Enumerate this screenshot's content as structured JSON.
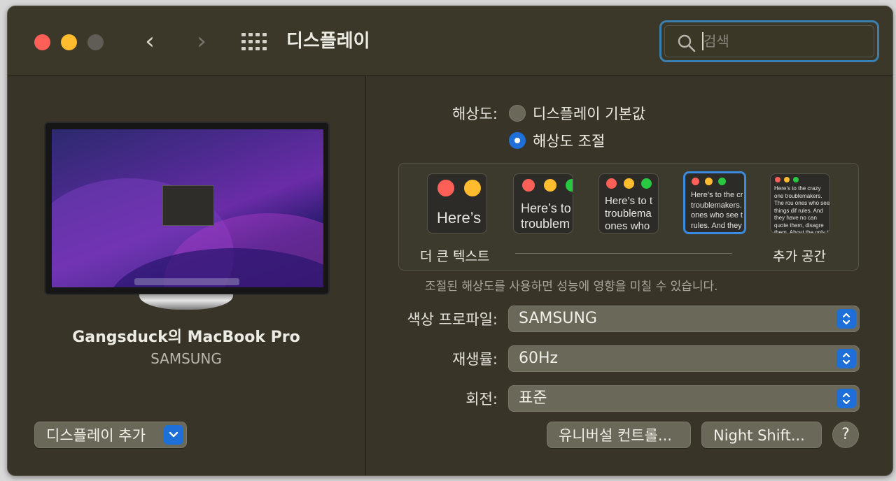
{
  "window": {
    "title": "디스플레이"
  },
  "search": {
    "placeholder": "검색",
    "value": ""
  },
  "device": {
    "name": "Gangsduck의 MacBook Pro",
    "model": "SAMSUNG"
  },
  "left": {
    "add_display_label": "디스플레이 추가"
  },
  "resolution": {
    "label": "해상도:",
    "options": [
      "디스플레이 기본값",
      "해상도 조절"
    ],
    "selected": "해상도 조절"
  },
  "scaling": {
    "left_label": "더 큰 텍스트",
    "right_label": "추가 공간",
    "selected_index": 3,
    "samples": [
      "Here’s",
      "Here’s to troublem",
      "Here’s to t troublema ones who",
      "Here’s to the cr troublemakers. ones who see t rules. And they",
      "Here’s to the crazy one troublemakers. The rou ones who see things dif rules. And they have no can quote them, disagre them. About the only th Because they change th"
    ],
    "note": "조절된 해상도를 사용하면 성능에 영향을 미칠 수 있습니다."
  },
  "color_profile": {
    "label": "색상 프로파일:",
    "value": "SAMSUNG"
  },
  "refresh_rate": {
    "label": "재생률:",
    "value": "60Hz"
  },
  "rotation": {
    "label": "회전:",
    "value": "표준"
  },
  "buttons": {
    "universal_control": "유니버설 컨트롤...",
    "night_shift": "Night Shift...",
    "help": "?"
  },
  "colors": {
    "accent": "#1e6fd8",
    "close": "#fe5f57",
    "minimize": "#febc2e",
    "zoom": "#28c840"
  }
}
